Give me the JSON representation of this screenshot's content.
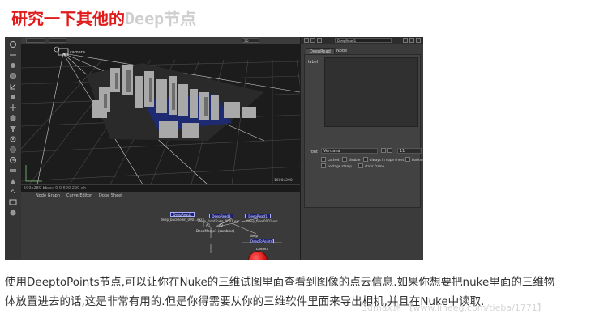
{
  "article": {
    "title_cn": "研究一下其他的",
    "title_en": "Deep",
    "title_cn_end": "节点",
    "paragraph_line1": "使用DeeptoPoints节点,可以让你在Nuke的三维试图里面查看到图像的点云信息.如果你想要把nuke里面的三维物",
    "paragraph_line2": "体放置进去的话,这是非常有用的.但是你得需要从你的三维软件里面来导出相机,并且在Nuke中读取.",
    "watermark": "3dmax迷 【www.lineeg.com/tieba/1771】"
  },
  "viewer": {
    "top_field_1": "",
    "top_field_2": "",
    "mode": "3D",
    "camera_label": "camera",
    "status_text": "599x289  bbox: 0 0 600 290 dh",
    "res_label": "1600x290"
  },
  "node_graph": {
    "tabs": [
      "Node Graph",
      "Curve Editor",
      "Dope Sheet"
    ],
    "nodes": {
      "deepread2": "DeepRead2",
      "deepread2_file": "deep_backTown_0001.exr",
      "deepread3": "DeepRead3",
      "deepread3_file": "deep_frontTown_0001.exr",
      "deepread1": "DeepRead1",
      "deepread1_file": "deep_floor0001.exr",
      "deepmerge": "DeepMerge1 (combine)",
      "deeptopoints": "DeepToPoints1",
      "deep_input": "deep",
      "camera_input": "camera",
      "a1_label": "A1",
      "a2_label": "A2"
    }
  },
  "properties": {
    "node_name": "DeepRead1",
    "tabs": [
      "DeepRead",
      "Node"
    ],
    "label_caption": "label",
    "font_caption": "font",
    "font_value": "Verdana",
    "font_size": "11",
    "checkboxes": [
      "cached",
      "disable",
      "always in dope sheet",
      "bookm"
    ],
    "postage_stamp": "postage stamp",
    "static_frame": "static frame"
  }
}
